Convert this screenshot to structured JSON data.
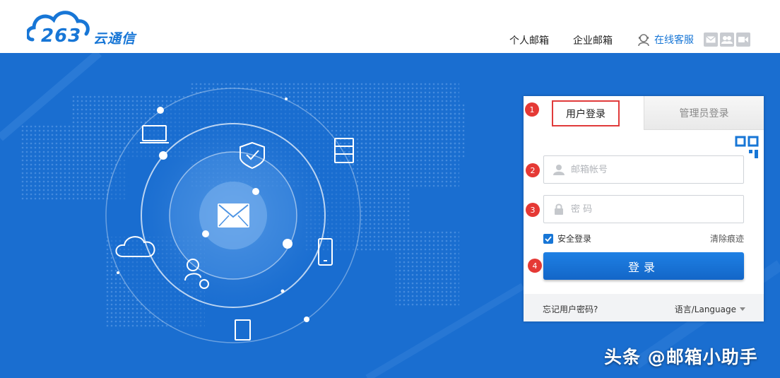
{
  "header": {
    "logo_text": "263",
    "logo_suffix": "云通信",
    "nav": {
      "personal": "个人邮箱",
      "enterprise": "企业邮箱"
    },
    "service_label": "在线客服",
    "icons": [
      "mail-icon",
      "group-icon",
      "video-icon"
    ]
  },
  "login": {
    "tabs": {
      "user": "用户登录",
      "admin": "管理员登录"
    },
    "account_placeholder": "邮箱帐号",
    "password_placeholder": "密 码",
    "remember_label": "安全登录",
    "remember_checked": true,
    "clear_label": "清除痕迹",
    "submit_label": "登录",
    "forgot_label": "忘记用户密码?",
    "language_label": "语言/Language",
    "markers": [
      "1",
      "2",
      "3",
      "4"
    ]
  },
  "watermark": "头条 @邮箱小助手",
  "colors": {
    "brand": "#1776d6",
    "banner": "#1a6ed0",
    "marker": "#e53935"
  }
}
